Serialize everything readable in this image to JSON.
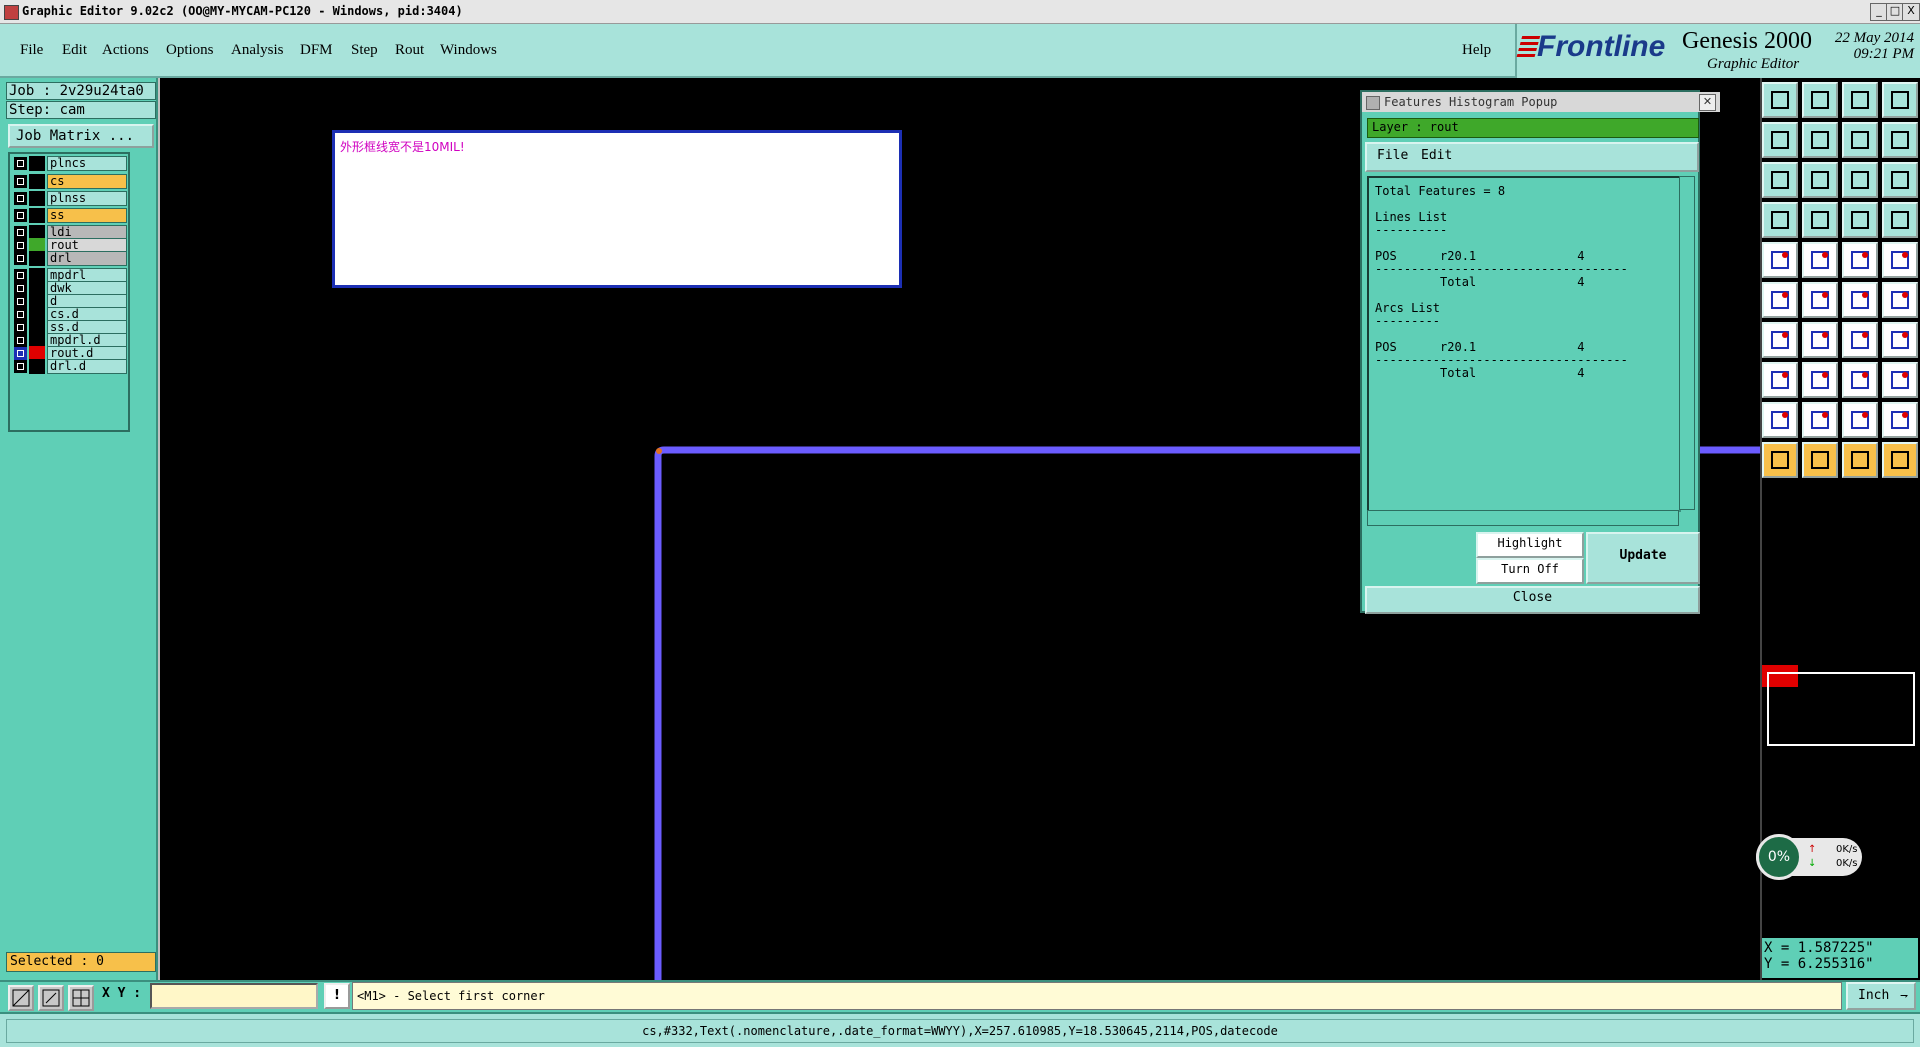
{
  "window": {
    "title": "Graphic Editor 9.02c2 (OO@MY-MYCAM-PC120 - Windows, pid:3404)",
    "controls": [
      "_",
      "□",
      "X"
    ]
  },
  "menubar": {
    "items": [
      "File",
      "Edit",
      "Actions",
      "Options",
      "Analysis",
      "DFM",
      "Step",
      "Rout",
      "Windows"
    ],
    "help": "Help"
  },
  "brand": {
    "logo": "Frontline",
    "product": "Genesis 2000",
    "subtitle": "Graphic Editor",
    "date": "22 May 2014",
    "time": "09:21 PM"
  },
  "left_panel": {
    "job": "Job : 2v29u24ta0",
    "step": "Step: cam",
    "job_matrix": "Job Matrix ...",
    "layers": [
      {
        "name": "plncs",
        "color": "#a8e3da",
        "swatch": "#000000"
      },
      {
        "name": "cs",
        "color": "#f7c04a",
        "swatch": "#000000"
      },
      {
        "name": "plnss",
        "color": "#a8e3da",
        "swatch": "#000000"
      },
      {
        "name": "ss",
        "color": "#f7c04a",
        "swatch": "#000000"
      },
      {
        "name": "ldi",
        "color": "#b8b8b8",
        "swatch": "#000000"
      },
      {
        "name": "rout",
        "color": "#d8d8d8",
        "swatch": "#3fa82a"
      },
      {
        "name": "drl",
        "color": "#b8b8b8",
        "swatch": "#000000"
      },
      {
        "name": "mpdrl",
        "color": "#a8e3da",
        "swatch": "#000000"
      },
      {
        "name": "dwk",
        "color": "#a8e3da",
        "swatch": "#000000"
      },
      {
        "name": "d",
        "color": "#a8e3da",
        "swatch": "#000000"
      },
      {
        "name": "cs.d",
        "color": "#a8e3da",
        "swatch": "#000000"
      },
      {
        "name": "ss.d",
        "color": "#a8e3da",
        "swatch": "#000000"
      },
      {
        "name": "mpdrl.d",
        "color": "#a8e3da",
        "swatch": "#000000"
      },
      {
        "name": "rout.d",
        "color": "#a8e3da",
        "swatch": "#e00000"
      },
      {
        "name": "drl.d",
        "color": "#a8e3da",
        "swatch": "#000000"
      }
    ],
    "selected": "Selected : 0"
  },
  "canvas": {
    "message": "外形框线宽不是10MIL!",
    "line_color": "#6b5cff"
  },
  "popup": {
    "title": "Features Histogram Popup",
    "layer": "Layer :  rout",
    "menu": [
      "File",
      "Edit"
    ],
    "lines": [
      "Total Features = 8",
      "",
      "Lines List",
      "----------",
      "",
      "POS      r20.1              4",
      "-----------------------------------",
      "         Total              4",
      "",
      "Arcs List",
      "---------",
      "",
      "POS      r20.1              4",
      "-----------------------------------",
      "         Total              4"
    ],
    "highlight": "Highlight",
    "turn_off": "Turn Off",
    "update": "Update",
    "close": "Close"
  },
  "speed_widget": {
    "percent": "0%",
    "up": "0K/s",
    "down": "0K/s"
  },
  "coords": {
    "x": "X = 1.587225\"",
    "y": "Y = 6.255316\""
  },
  "bottom": {
    "xy_label": "X Y :",
    "xy_value": "",
    "exclaim": "!",
    "prompt": "<M1> - Select first corner",
    "units": "Inch"
  },
  "status": "cs,#332,Text(.nomenclature,.date_format=WWYY),X=257.610985,Y=18.530645,2114,POS,datecode"
}
